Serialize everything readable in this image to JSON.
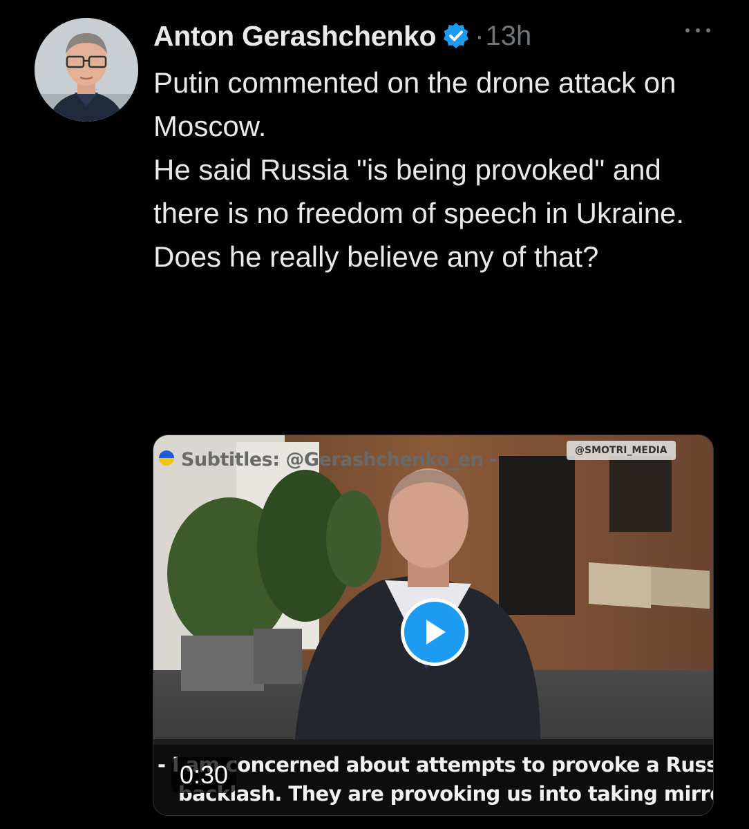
{
  "author": {
    "name": "Anton Gerashchenko",
    "verified_icon": "verified-badge-icon",
    "separator": "·",
    "time": "13h"
  },
  "more_icon": "more-options-icon",
  "tweet_text": {
    "p1": "Putin commented on the drone attack on Moscow.",
    "p2": "He said Russia \"is being provoked\" and there is no freedom of speech in Ukraine.",
    "p3": "Does he really believe any of that?"
  },
  "video": {
    "subtitles_label": "Subtitles: @Gerashchenko_en -",
    "watermark": "@SMOTRI_MEDIA",
    "caption_line1": "- I am concerned about attempts to provoke a Russian",
    "caption_line2": "backlash. They are provoking us into taking mirror",
    "duration": "0:30",
    "play_icon": "play-icon"
  },
  "colors": {
    "background": "#000000",
    "text": "#e7e9ea",
    "muted": "#71767b",
    "accent": "#1d9bf0"
  }
}
